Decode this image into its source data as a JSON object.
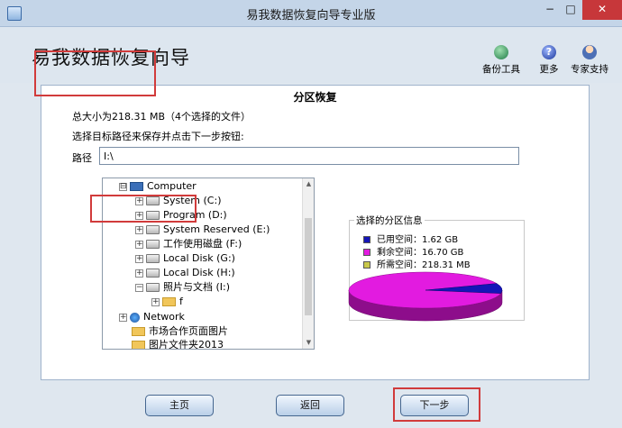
{
  "window": {
    "title": "易我数据恢复向导专业版",
    "min_label": "−",
    "max_label": "□",
    "close_label": "✕"
  },
  "header": {
    "title": "易我数据恢复向导",
    "tools": [
      {
        "label": "备份工具",
        "icon": "backup-icon"
      },
      {
        "label": "更多",
        "icon": "help-icon",
        "glyph": "?"
      },
      {
        "label": "专家支持",
        "icon": "support-icon"
      }
    ]
  },
  "section": {
    "title": "分区恢复",
    "total_size": "总大小为218.31 MB（4个选择的文件）",
    "instruction": "选择目标路径来保存并点击下一步按钮:",
    "path_label": "路径",
    "path_value": "I:\\"
  },
  "tree": {
    "items": [
      {
        "label": "Computer",
        "exp": "⊟",
        "icon": "computer-icon"
      },
      {
        "label": "System (C:)",
        "exp": "+",
        "icon": "drive-icon"
      },
      {
        "label": "Program (D:)",
        "exp": "+",
        "icon": "drive-icon"
      },
      {
        "label": "System Reserved (E:)",
        "exp": "+",
        "icon": "drive-icon"
      },
      {
        "label": "工作使用磁盘 (F:)",
        "exp": "+",
        "icon": "drive-icon"
      },
      {
        "label": "Local Disk (G:)",
        "exp": "+",
        "icon": "drive-icon"
      },
      {
        "label": "Local Disk (H:)",
        "exp": "+",
        "icon": "drive-icon"
      },
      {
        "label": "照片与文档 (I:)",
        "exp": "−",
        "icon": "drive-icon"
      },
      {
        "label": "f",
        "exp": "+",
        "icon": "folder-icon"
      },
      {
        "label": "Network",
        "exp": "+",
        "icon": "network-icon"
      },
      {
        "label": "市场合作页面图片",
        "exp": "",
        "icon": "folder-icon"
      },
      {
        "label": "图片文件夹2013",
        "exp": "",
        "icon": "folder-icon"
      }
    ]
  },
  "partition_info": {
    "title": "选择的分区信息",
    "legend": [
      {
        "label": "已用空间：1.62 GB",
        "color": "#1515b8"
      },
      {
        "label": "剩余空间：16.70 GB",
        "color": "#e21be0"
      },
      {
        "label": "所需空间：218.31 MB",
        "color": "#c8c84a"
      }
    ],
    "used_gb": 1.62,
    "free_gb": 16.7
  },
  "footer": {
    "home": "主页",
    "back": "返回",
    "next": "下一步"
  }
}
